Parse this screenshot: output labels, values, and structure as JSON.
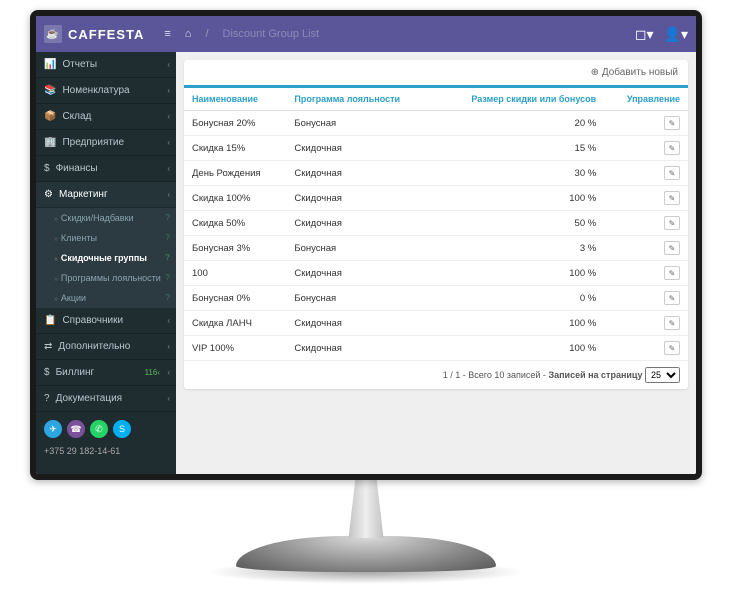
{
  "brand": "CAFFESTA",
  "breadcrumb": "Discount Group List",
  "sidebar": {
    "items": [
      {
        "icon": "📊",
        "label": "Отчеты"
      },
      {
        "icon": "📚",
        "label": "Номенклатура"
      },
      {
        "icon": "📦",
        "label": "Склад"
      },
      {
        "icon": "🏢",
        "label": "Предприятие"
      },
      {
        "icon": "$",
        "label": "Финансы"
      },
      {
        "icon": "⚙",
        "label": "Маркетинг",
        "active": true
      },
      {
        "icon": "📋",
        "label": "Справочники"
      },
      {
        "icon": "⇄",
        "label": "Дополнительно"
      },
      {
        "icon": "$",
        "label": "Биллинг",
        "badge": "116"
      },
      {
        "icon": "?",
        "label": "Документация"
      }
    ],
    "subs": [
      {
        "label": "Скидки/Надбавки"
      },
      {
        "label": "Клиенты"
      },
      {
        "label": "Скидочные группы",
        "active": true
      },
      {
        "label": "Программы лояльности"
      },
      {
        "label": "Акции"
      }
    ],
    "phone": "+375 29 182-14-61"
  },
  "panel": {
    "add_label": "Добавить новый",
    "cols": [
      "Наименование",
      "Программа лояльности",
      "Размер скидки или бонусов",
      "Управление"
    ],
    "rows": [
      {
        "name": "Бонусная 20%",
        "prog": "Бонусная",
        "val": "20 %"
      },
      {
        "name": "Скидка 15%",
        "prog": "Скидочная",
        "val": "15 %"
      },
      {
        "name": "День Рождения",
        "prog": "Скидочная",
        "val": "30 %"
      },
      {
        "name": "Скидка 100%",
        "prog": "Скидочная",
        "val": "100 %"
      },
      {
        "name": "Скидка 50%",
        "prog": "Скидочная",
        "val": "50 %"
      },
      {
        "name": "Бонусная 3%",
        "prog": "Бонусная",
        "val": "3 %"
      },
      {
        "name": "100",
        "prog": "Скидочная",
        "val": "100 %"
      },
      {
        "name": "Бонусная 0%",
        "prog": "Бонусная",
        "val": "0 %"
      },
      {
        "name": "Скидка ЛАНЧ",
        "prog": "Скидочная",
        "val": "100 %"
      },
      {
        "name": "VIP 100%",
        "prog": "Скидочная",
        "val": "100 %"
      }
    ],
    "pager_info": "1 / 1  -  Всего 10 записей  -",
    "pager_label": "Записей на страницу",
    "page_size": "25"
  }
}
